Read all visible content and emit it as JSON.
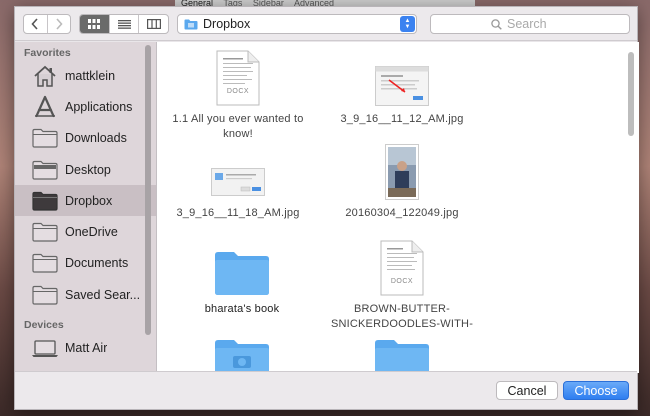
{
  "background_tabs": [
    "General",
    "Tags",
    "Sidebar",
    "Advanced"
  ],
  "toolbar": {
    "back_icon": "chevron-left-icon",
    "forward_icon": "chevron-right-icon",
    "view_modes": [
      "icon-view",
      "list-view",
      "column-view"
    ],
    "selected_view": "icon-view",
    "location": "Dropbox",
    "search_placeholder": "Search"
  },
  "sidebar": {
    "favorites_heading": "Favorites",
    "favorites": [
      {
        "label": "mattklein",
        "icon": "home-icon"
      },
      {
        "label": "Applications",
        "icon": "applications-icon"
      },
      {
        "label": "Downloads",
        "icon": "folder-icon"
      },
      {
        "label": "Desktop",
        "icon": "desktop-icon"
      },
      {
        "label": "Dropbox",
        "icon": "folder-icon",
        "selected": true
      },
      {
        "label": "OneDrive",
        "icon": "folder-icon"
      },
      {
        "label": "Documents",
        "icon": "folder-icon"
      },
      {
        "label": "Saved Sear...",
        "icon": "folder-icon"
      }
    ],
    "devices_heading": "Devices",
    "devices": [
      {
        "label": "Matt Air",
        "icon": "laptop-icon"
      }
    ]
  },
  "files": [
    {
      "name_line1": "1.1 All you ever wanted to",
      "name_line2": "know!",
      "kind": "docx",
      "badge": "DOCX"
    },
    {
      "name_line1": "3_9_16__11_12_AM.jpg",
      "name_line2": "",
      "kind": "screenshot"
    },
    {
      "name_line1": "3_9_16__11_18_AM.jpg",
      "name_line2": "",
      "kind": "dialog-image"
    },
    {
      "name_line1": "20160304_122049.jpg",
      "name_line2": "",
      "kind": "photo"
    },
    {
      "name_line1": "bharata's book",
      "name_line2": "",
      "kind": "folder"
    },
    {
      "name_line1": "BROWN-BUTTER-",
      "name_line2": "SNICKERDOODLES-WITH-",
      "kind": "docx",
      "badge": "DOCX"
    },
    {
      "name_line1": "",
      "name_line2": "",
      "kind": "camera-folder"
    },
    {
      "name_line1": "",
      "name_line2": "",
      "kind": "folder"
    }
  ],
  "footer": {
    "cancel_label": "Cancel",
    "choose_label": "Choose"
  },
  "colors": {
    "accent": "#2f7ef0",
    "folder": "#6ab4f0",
    "sidebar_bg": "#ded6da",
    "sidebar_selected": "#c9bfc4"
  }
}
